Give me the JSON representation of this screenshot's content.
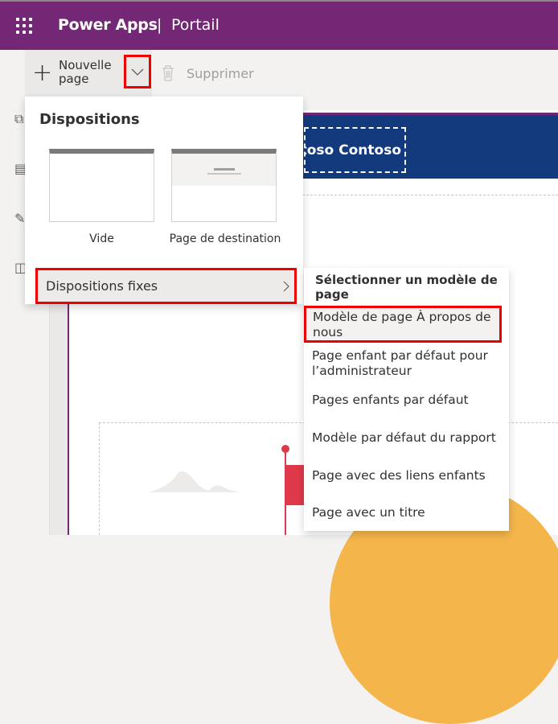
{
  "header": {
    "app_name": "Power Apps",
    "separator": "|",
    "section": "Portail"
  },
  "toolbar": {
    "new_page_label": "Nouvelle page",
    "delete_label": "Supprimer"
  },
  "site": {
    "brand": "toso Contoso"
  },
  "layouts_menu": {
    "title": "Dispositions",
    "options": [
      {
        "label": "Vide"
      },
      {
        "label": "Page de destination"
      }
    ],
    "fixed_layouts_label": "Dispositions fixes"
  },
  "templates_submenu": {
    "header": "Sélectionner un modèle de page",
    "items": [
      "Modèle de page À propos de nous",
      "Page enfant par défaut pour l’administrateur",
      "Pages enfants par défaut",
      "Modèle par défaut du rapport",
      "Page avec des liens enfants",
      "Page avec un titre"
    ],
    "selected_index": 0
  },
  "colors": {
    "header": "#742774",
    "banner": "#143a7e",
    "highlight": "#ff0000"
  }
}
